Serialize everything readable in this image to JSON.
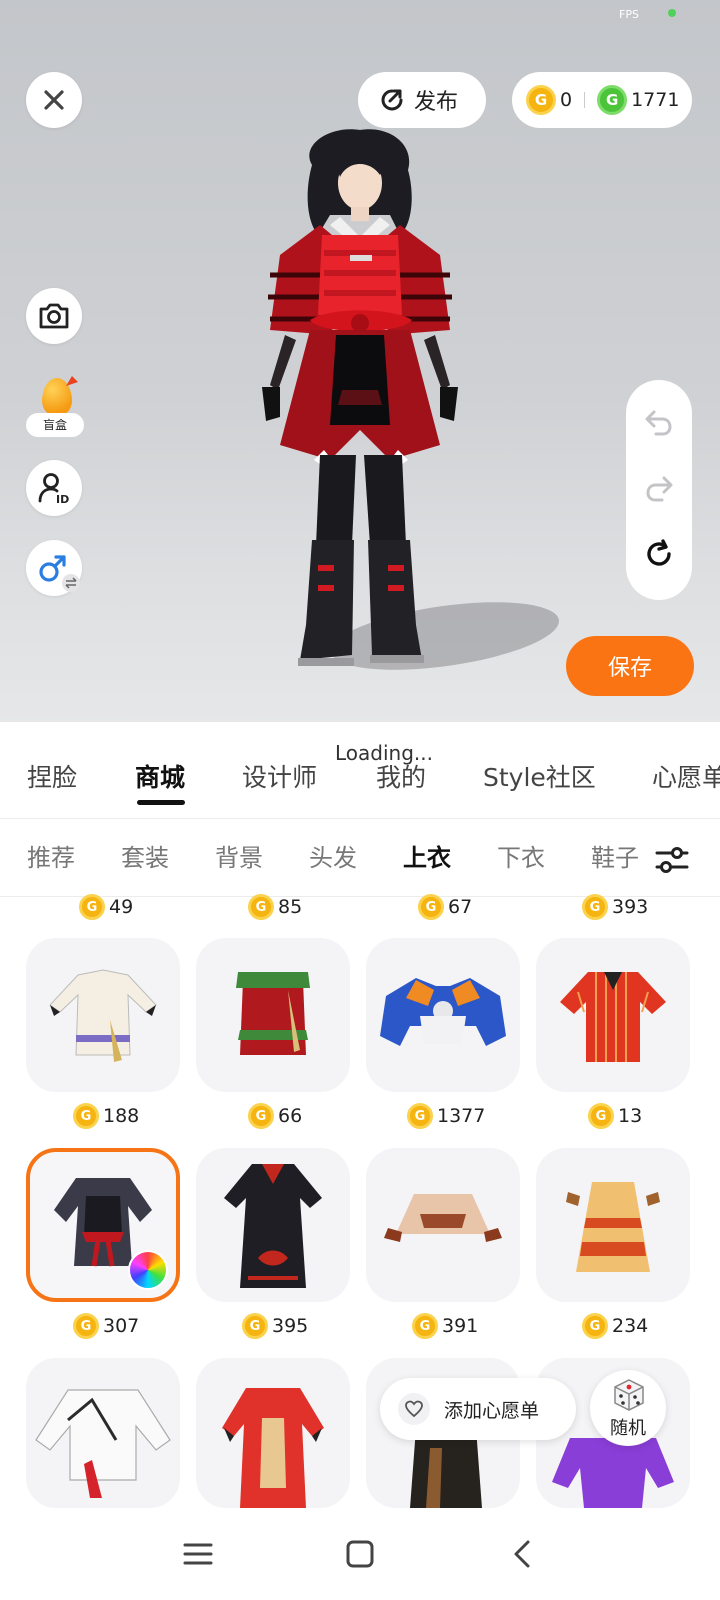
{
  "status": {
    "fps_label": "FPS"
  },
  "top_bar": {
    "publish_label": "发布",
    "currency": [
      {
        "icon": "gold-coin-icon",
        "value": "0"
      },
      {
        "icon": "green-coin-icon",
        "value": "1771"
      }
    ]
  },
  "left_tools": {
    "blindbox_label": "盲盒"
  },
  "save_label": "保存",
  "loading_text": "Loading...",
  "main_tabs": [
    "捏脸",
    "商城",
    "设计师",
    "我的",
    "Style社区",
    "心愿单"
  ],
  "active_main_tab": "商城",
  "sub_tabs": [
    "推荐",
    "套装",
    "背景",
    "头发",
    "上衣",
    "下衣",
    "鞋子"
  ],
  "active_sub_tab": "上衣",
  "top_row_prices": [
    "49",
    "85",
    "67",
    "393"
  ],
  "items": [
    {
      "price": "188",
      "name": "white-robe-top"
    },
    {
      "price": "66",
      "name": "red-green-vest"
    },
    {
      "price": "1377",
      "name": "blue-mech-armor"
    },
    {
      "price": "13",
      "name": "red-striped-shirt"
    },
    {
      "price": "307",
      "name": "samurai-armor-top",
      "selected": true
    },
    {
      "price": "395",
      "name": "black-cloud-coat"
    },
    {
      "price": "391",
      "name": "tan-poncho"
    },
    {
      "price": "234",
      "name": "yellow-red-poncho"
    },
    {
      "price": "",
      "name": "white-red-shirt"
    },
    {
      "price": "",
      "name": "red-long-coat"
    },
    {
      "price": "",
      "name": "black-coat"
    },
    {
      "price": "",
      "name": "purple-jacket"
    }
  ],
  "wishlist_label": "添加心愿单",
  "random_label": "随机",
  "colors": {
    "accent": "#fb7414",
    "coin_gold": "#f5b40f",
    "coin_green": "#4cc43a"
  }
}
